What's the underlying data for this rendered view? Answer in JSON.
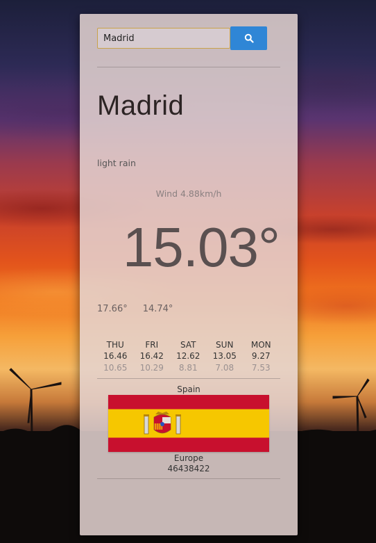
{
  "search": {
    "value": "Madrid",
    "button_icon": "search-icon",
    "button_color": "#2f86d6"
  },
  "weather": {
    "city": "Madrid",
    "description": "light rain",
    "wind": "Wind 4.88km/h",
    "temperature": "15.03°",
    "temp_max": "17.66°",
    "temp_min": "14.74°"
  },
  "forecast": [
    {
      "day": "THU",
      "high": "16.46",
      "low": "10.65"
    },
    {
      "day": "FRI",
      "high": "16.42",
      "low": "10.29"
    },
    {
      "day": "SAT",
      "high": "12.62",
      "low": "8.81"
    },
    {
      "day": "SUN",
      "high": "13.05",
      "low": "7.08"
    },
    {
      "day": "MON",
      "high": "9.27",
      "low": "7.53"
    }
  ],
  "country": {
    "name": "Spain",
    "flag": "spain-flag",
    "region": "Europe",
    "population": "46438422"
  },
  "colors": {
    "flag_red": "#c8102e",
    "flag_yellow": "#f6c700"
  }
}
